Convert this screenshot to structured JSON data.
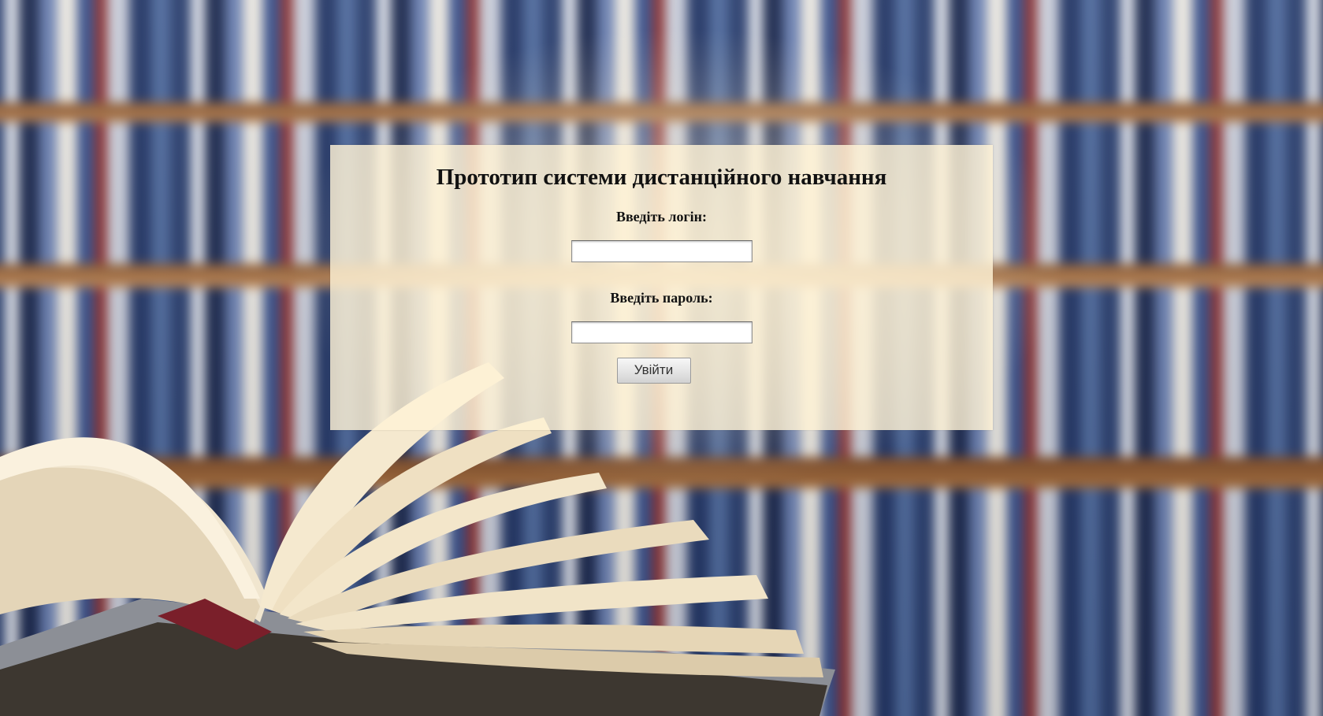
{
  "login_page": {
    "title": "Прототип системи дистанційного навчання",
    "login_label": "Введіть логін:",
    "login_value": "",
    "password_label": "Введіть пароль:",
    "password_value": "",
    "submit_label": "Увійти"
  }
}
